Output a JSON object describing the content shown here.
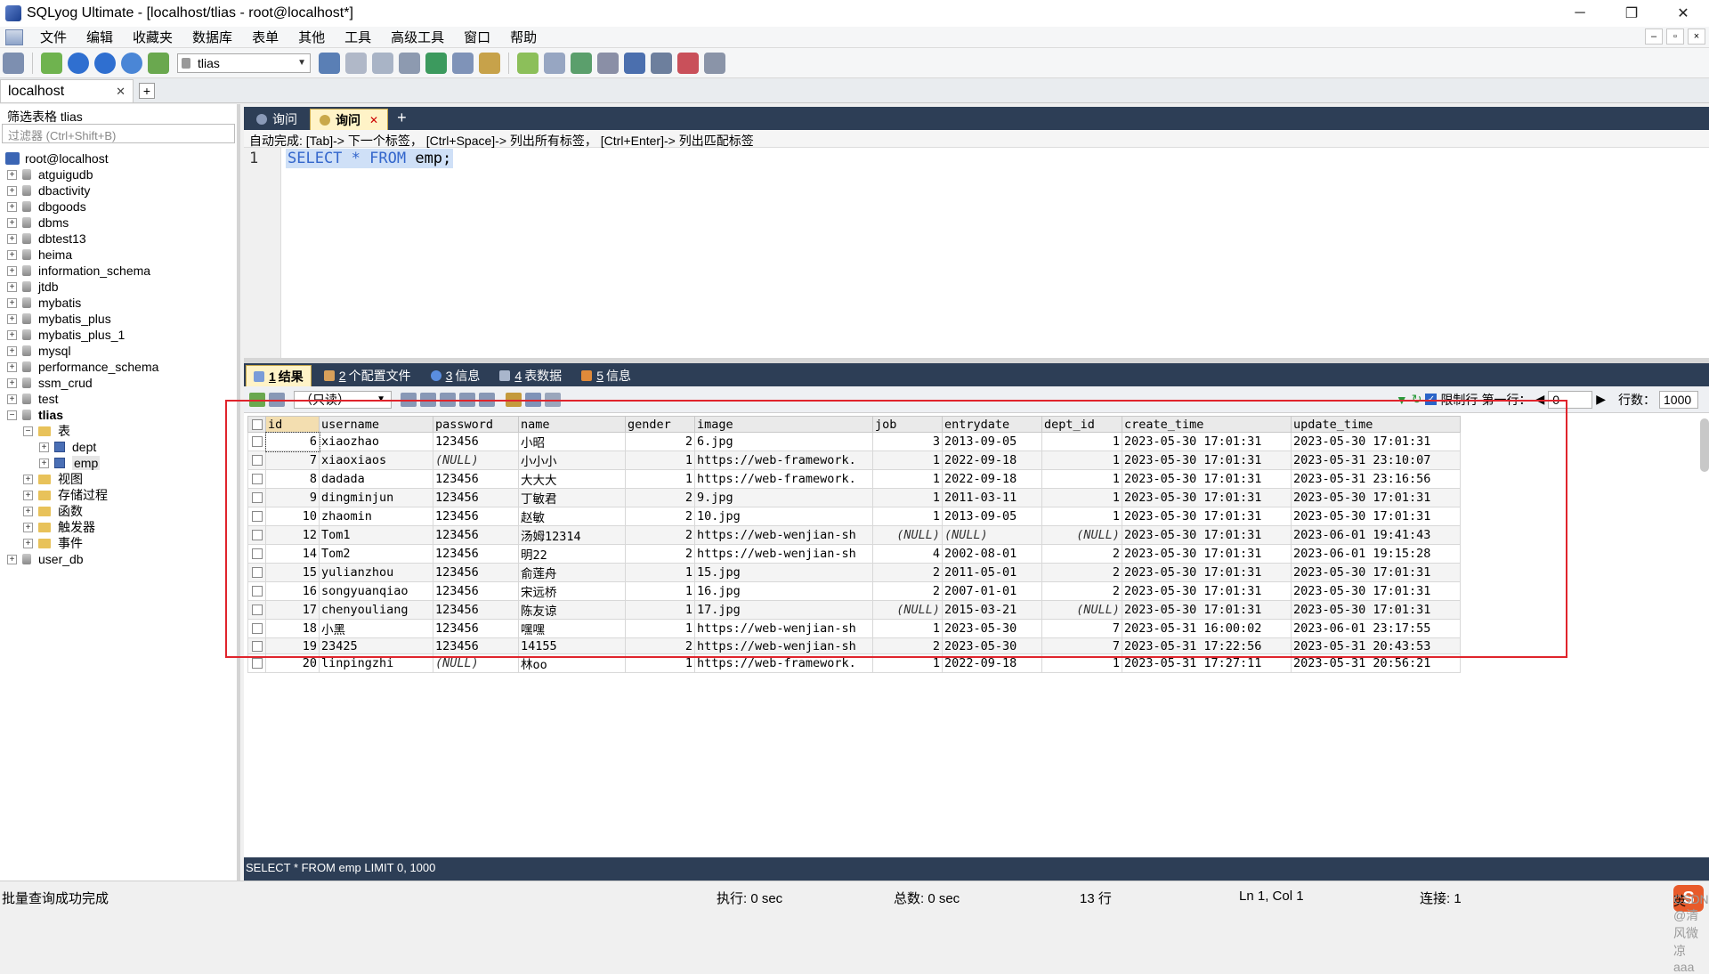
{
  "window": {
    "title": "SQLyog Ultimate - [localhost/tlias - root@localhost*]",
    "controls": [
      "─",
      "❐",
      "✕"
    ]
  },
  "menu": [
    "文件",
    "编辑",
    "收藏夹",
    "数据库",
    "表单",
    "其他",
    "工具",
    "高级工具",
    "窗口",
    "帮助"
  ],
  "toolbar": {
    "db_select": "tlias"
  },
  "connection_tab": {
    "label": "localhost"
  },
  "left_panel": {
    "filter_label": "筛选表格 tlias",
    "filter_placeholder": "过滤器 (Ctrl+Shift+B)",
    "root": "root@localhost",
    "databases": [
      "atguigudb",
      "dbactivity",
      "dbgoods",
      "dbms",
      "dbtest13",
      "heima",
      "information_schema",
      "jtdb",
      "mybatis",
      "mybatis_plus",
      "mybatis_plus_1",
      "mysql",
      "performance_schema",
      "ssm_crud",
      "test"
    ],
    "active_db": "tlias",
    "tables_folder": "表",
    "tables": [
      "dept",
      "emp"
    ],
    "folders": [
      "视图",
      "存储过程",
      "函数",
      "触发器",
      "事件"
    ],
    "after_db": "user_db"
  },
  "query_tabs": [
    {
      "label": "询问"
    },
    {
      "label": "询问",
      "active": true
    }
  ],
  "autocomplete_hint": "自动完成: [Tab]-> 下一个标签， [Ctrl+Space]-> 列出所有标签， [Ctrl+Enter]-> 列出匹配标签",
  "editor": {
    "line_number": "1",
    "sql_kw1": "SELECT",
    "sql_star": " * ",
    "sql_kw2": "FROM",
    "sql_rest": " emp;"
  },
  "result_tabs": [
    {
      "num": "1",
      "label": "结果",
      "active": true
    },
    {
      "num": "2",
      "label": "个配置文件"
    },
    {
      "num": "3",
      "label": "信息"
    },
    {
      "num": "4",
      "label": "表数据"
    },
    {
      "num": "5",
      "label": "信息"
    }
  ],
  "result_toolbar": {
    "mode": "（只读）",
    "limit_label": "限制行",
    "first_row_label": "第一行：",
    "first_row": "0",
    "rows_label": "行数：",
    "rows": "1000"
  },
  "grid": {
    "columns": [
      "id",
      "username",
      "password",
      "name",
      "gender",
      "image",
      "job",
      "entrydate",
      "dept_id",
      "create_time",
      "update_time"
    ],
    "rows": [
      [
        "6",
        "xiaozhao",
        "123456",
        "小昭",
        "2",
        "6.jpg",
        "3",
        "2013-09-05",
        "1",
        "2023-05-30 17:01:31",
        "2023-05-30 17:01:31"
      ],
      [
        "7",
        "xiaoxiaos",
        "(NULL)",
        "小小小",
        "1",
        "https://web-framework.",
        "1",
        "2022-09-18",
        "1",
        "2023-05-30 17:01:31",
        "2023-05-31 23:10:07"
      ],
      [
        "8",
        "dadada",
        "123456",
        "大大大",
        "1",
        "https://web-framework.",
        "1",
        "2022-09-18",
        "1",
        "2023-05-30 17:01:31",
        "2023-05-31 23:16:56"
      ],
      [
        "9",
        "dingminjun",
        "123456",
        "丁敏君",
        "2",
        "9.jpg",
        "1",
        "2011-03-11",
        "1",
        "2023-05-30 17:01:31",
        "2023-05-30 17:01:31"
      ],
      [
        "10",
        "zhaomin",
        "123456",
        "赵敏",
        "2",
        "10.jpg",
        "1",
        "2013-09-05",
        "1",
        "2023-05-30 17:01:31",
        "2023-05-30 17:01:31"
      ],
      [
        "12",
        "Tom1",
        "123456",
        "汤姆12314",
        "2",
        "https://web-wenjian-sh",
        "(NULL)",
        "(NULL)",
        "(NULL)",
        "2023-05-30 17:01:31",
        "2023-06-01 19:41:43"
      ],
      [
        "14",
        "Tom2",
        "123456",
        "明22",
        "2",
        "https://web-wenjian-sh",
        "4",
        "2002-08-01",
        "2",
        "2023-05-30 17:01:31",
        "2023-06-01 19:15:28"
      ],
      [
        "15",
        "yulianzhou",
        "123456",
        "俞莲舟",
        "1",
        "15.jpg",
        "2",
        "2011-05-01",
        "2",
        "2023-05-30 17:01:31",
        "2023-05-30 17:01:31"
      ],
      [
        "16",
        "songyuanqiao",
        "123456",
        "宋远桥",
        "1",
        "16.jpg",
        "2",
        "2007-01-01",
        "2",
        "2023-05-30 17:01:31",
        "2023-05-30 17:01:31"
      ],
      [
        "17",
        "chenyouliang",
        "123456",
        "陈友谅",
        "1",
        "17.jpg",
        "(NULL)",
        "2015-03-21",
        "(NULL)",
        "2023-05-30 17:01:31",
        "2023-05-30 17:01:31"
      ],
      [
        "18",
        "小黑",
        "123456",
        "嘿嘿",
        "1",
        "https://web-wenjian-sh",
        "1",
        "2023-05-30",
        "7",
        "2023-05-31 16:00:02",
        "2023-06-01 23:17:55"
      ],
      [
        "19",
        "23425",
        "123456",
        "14155",
        "2",
        "https://web-wenjian-sh",
        "2",
        "2023-05-30",
        "7",
        "2023-05-31 17:22:56",
        "2023-05-31 20:43:53"
      ],
      [
        "20",
        "linpingzhi",
        "(NULL)",
        "林oo",
        "1",
        "https://web-framework.",
        "1",
        "2022-09-18",
        "1",
        "2023-05-31 17:27:11",
        "2023-05-31 20:56:21"
      ]
    ]
  },
  "query_status": "SELECT * FROM emp LIMIT 0, 1000",
  "statusbar": {
    "message": "批量查询成功完成",
    "exec": "执行: 0 sec",
    "total": "总数: 0 sec",
    "rows": "13 行",
    "position": "Ln 1, Col 1",
    "connections": "连接: 1",
    "ime_lang": "英",
    "watermark": "CSDN @清风微凉 aaa"
  },
  "colors": {
    "dark_tabbar": "#2d3e56",
    "active_tab": "#fff3c7",
    "highlight_box": "#e0242c",
    "sql_keyword": "#3366cc"
  }
}
